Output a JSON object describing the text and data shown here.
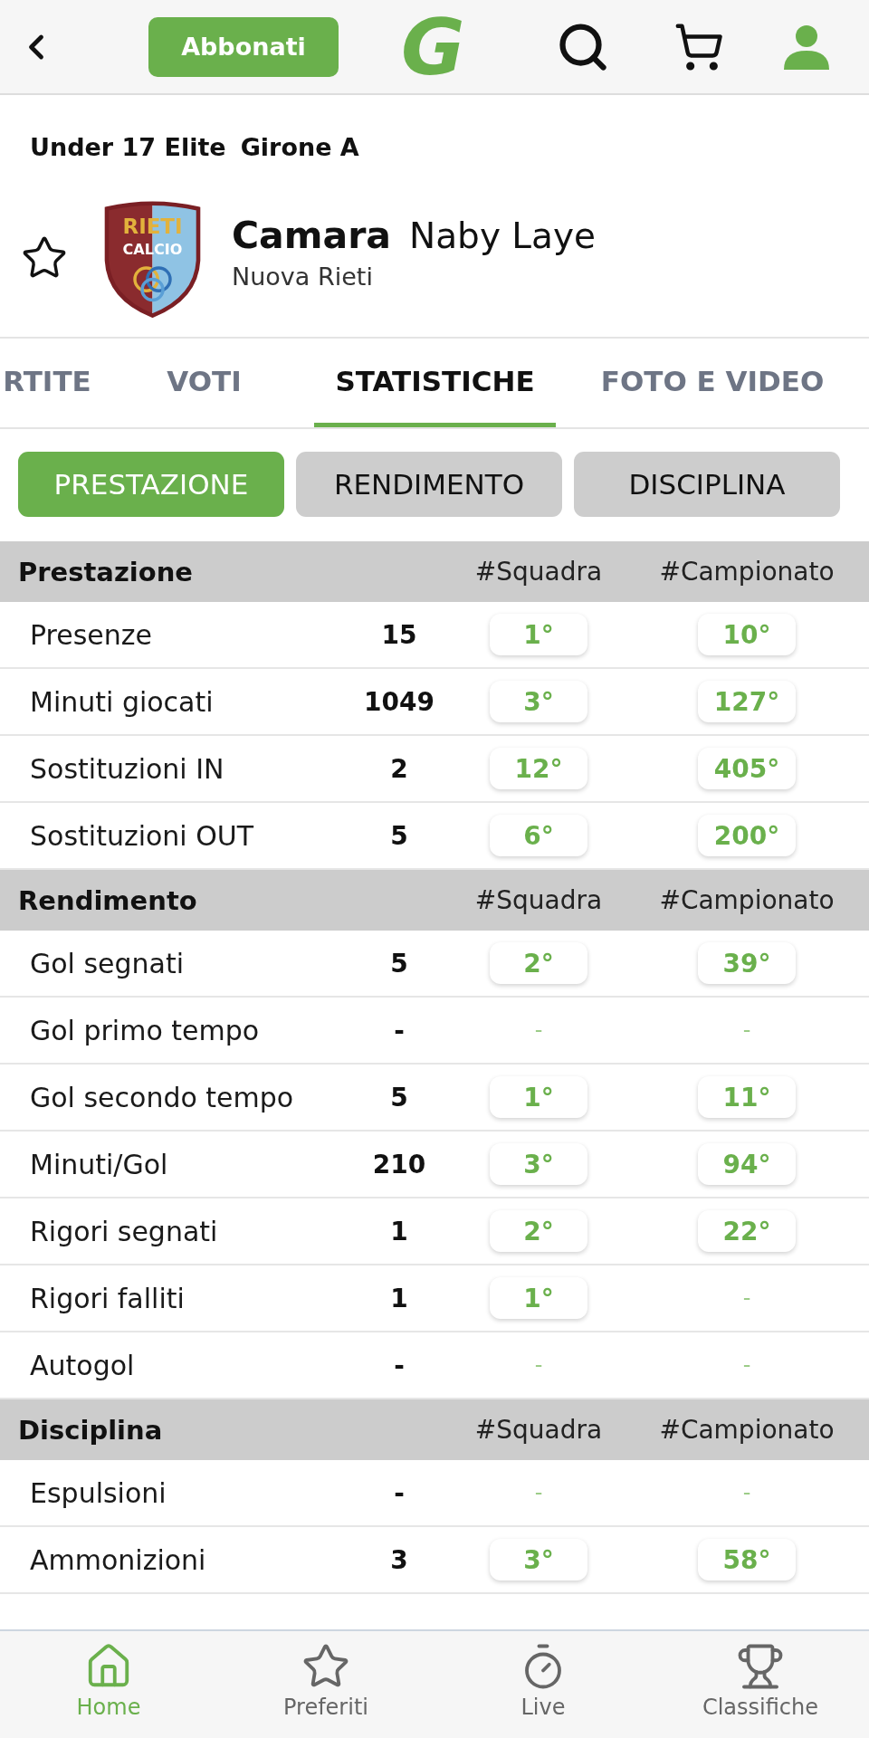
{
  "top_bar": {
    "subscribe_button": "Abbonati",
    "logo": "G"
  },
  "competition": {
    "name": "Under 17 Elite",
    "group": "Girone A"
  },
  "player": {
    "surname": "Camara",
    "first_name": "Naby Laye",
    "team": "Nuova Rieti",
    "favorite": false,
    "crest": {
      "line_1": "RIETI",
      "line_2": "CALCIO"
    }
  },
  "tabs": [
    {
      "label": "RTITE",
      "selected": false
    },
    {
      "label": "VOTI",
      "selected": false
    },
    {
      "label": "STATISTICHE",
      "selected": true
    },
    {
      "label": "FOTO E VIDEO",
      "selected": false
    }
  ],
  "filters": [
    {
      "label": "PRESTAZIONE",
      "selected": true
    },
    {
      "label": "RENDIMENTO",
      "selected": false
    },
    {
      "label": "DISCIPLINA",
      "selected": false
    }
  ],
  "sections": [
    {
      "title": "Prestazione",
      "columns": [
        "#Squadra",
        "#Campionato"
      ],
      "rows": [
        {
          "label": "Presenze",
          "value": "15",
          "team_rank": {
            "kind": "pill",
            "text": "1°"
          },
          "league_rank": {
            "kind": "pill",
            "text": "10°"
          }
        },
        {
          "label": "Minuti giocati",
          "value": "1049",
          "team_rank": {
            "kind": "pill",
            "text": "3°"
          },
          "league_rank": {
            "kind": "pill",
            "text": "127°"
          }
        },
        {
          "label": "Sostituzioni IN",
          "value": "2",
          "team_rank": {
            "kind": "pill",
            "text": "12°"
          },
          "league_rank": {
            "kind": "pill",
            "text": "405°"
          }
        },
        {
          "label": "Sostituzioni OUT",
          "value": "5",
          "team_rank": {
            "kind": "pill",
            "text": "6°"
          },
          "league_rank": {
            "kind": "pill",
            "text": "200°"
          }
        }
      ]
    },
    {
      "title": "Rendimento",
      "columns": [
        "#Squadra",
        "#Campionato"
      ],
      "rows": [
        {
          "label": "Gol segnati",
          "value": "5",
          "team_rank": {
            "kind": "pill",
            "text": "2°"
          },
          "league_rank": {
            "kind": "pill",
            "text": "39°"
          }
        },
        {
          "label": "Gol primo tempo",
          "value": "-",
          "team_rank": {
            "kind": "dash",
            "text": "-"
          },
          "league_rank": {
            "kind": "dash",
            "text": "-"
          }
        },
        {
          "label": "Gol secondo tempo",
          "value": "5",
          "team_rank": {
            "kind": "pill",
            "text": "1°"
          },
          "league_rank": {
            "kind": "pill",
            "text": "11°"
          }
        },
        {
          "label": "Minuti/Gol",
          "value": "210",
          "team_rank": {
            "kind": "pill",
            "text": "3°"
          },
          "league_rank": {
            "kind": "pill",
            "text": "94°"
          }
        },
        {
          "label": "Rigori segnati",
          "value": "1",
          "team_rank": {
            "kind": "pill",
            "text": "2°"
          },
          "league_rank": {
            "kind": "pill",
            "text": "22°"
          }
        },
        {
          "label": "Rigori falliti",
          "value": "1",
          "team_rank": {
            "kind": "pill",
            "text": "1°"
          },
          "league_rank": {
            "kind": "dash",
            "text": "-"
          }
        },
        {
          "label": "Autogol",
          "value": "-",
          "team_rank": {
            "kind": "dash",
            "text": "-"
          },
          "league_rank": {
            "kind": "dash",
            "text": "-"
          }
        }
      ]
    },
    {
      "title": "Disciplina",
      "columns": [
        "#Squadra",
        "#Campionato"
      ],
      "rows": [
        {
          "label": "Espulsioni",
          "value": "-",
          "team_rank": {
            "kind": "dash",
            "text": "-"
          },
          "league_rank": {
            "kind": "dash",
            "text": "-"
          }
        },
        {
          "label": "Ammonizioni",
          "value": "3",
          "team_rank": {
            "kind": "pill",
            "text": "3°"
          },
          "league_rank": {
            "kind": "pill",
            "text": "58°"
          }
        }
      ]
    }
  ],
  "bottom_nav": [
    {
      "label": "Home",
      "selected": true
    },
    {
      "label": "Preferiti",
      "selected": false
    },
    {
      "label": "Live",
      "selected": false
    },
    {
      "label": "Classifiche",
      "selected": false
    }
  ]
}
